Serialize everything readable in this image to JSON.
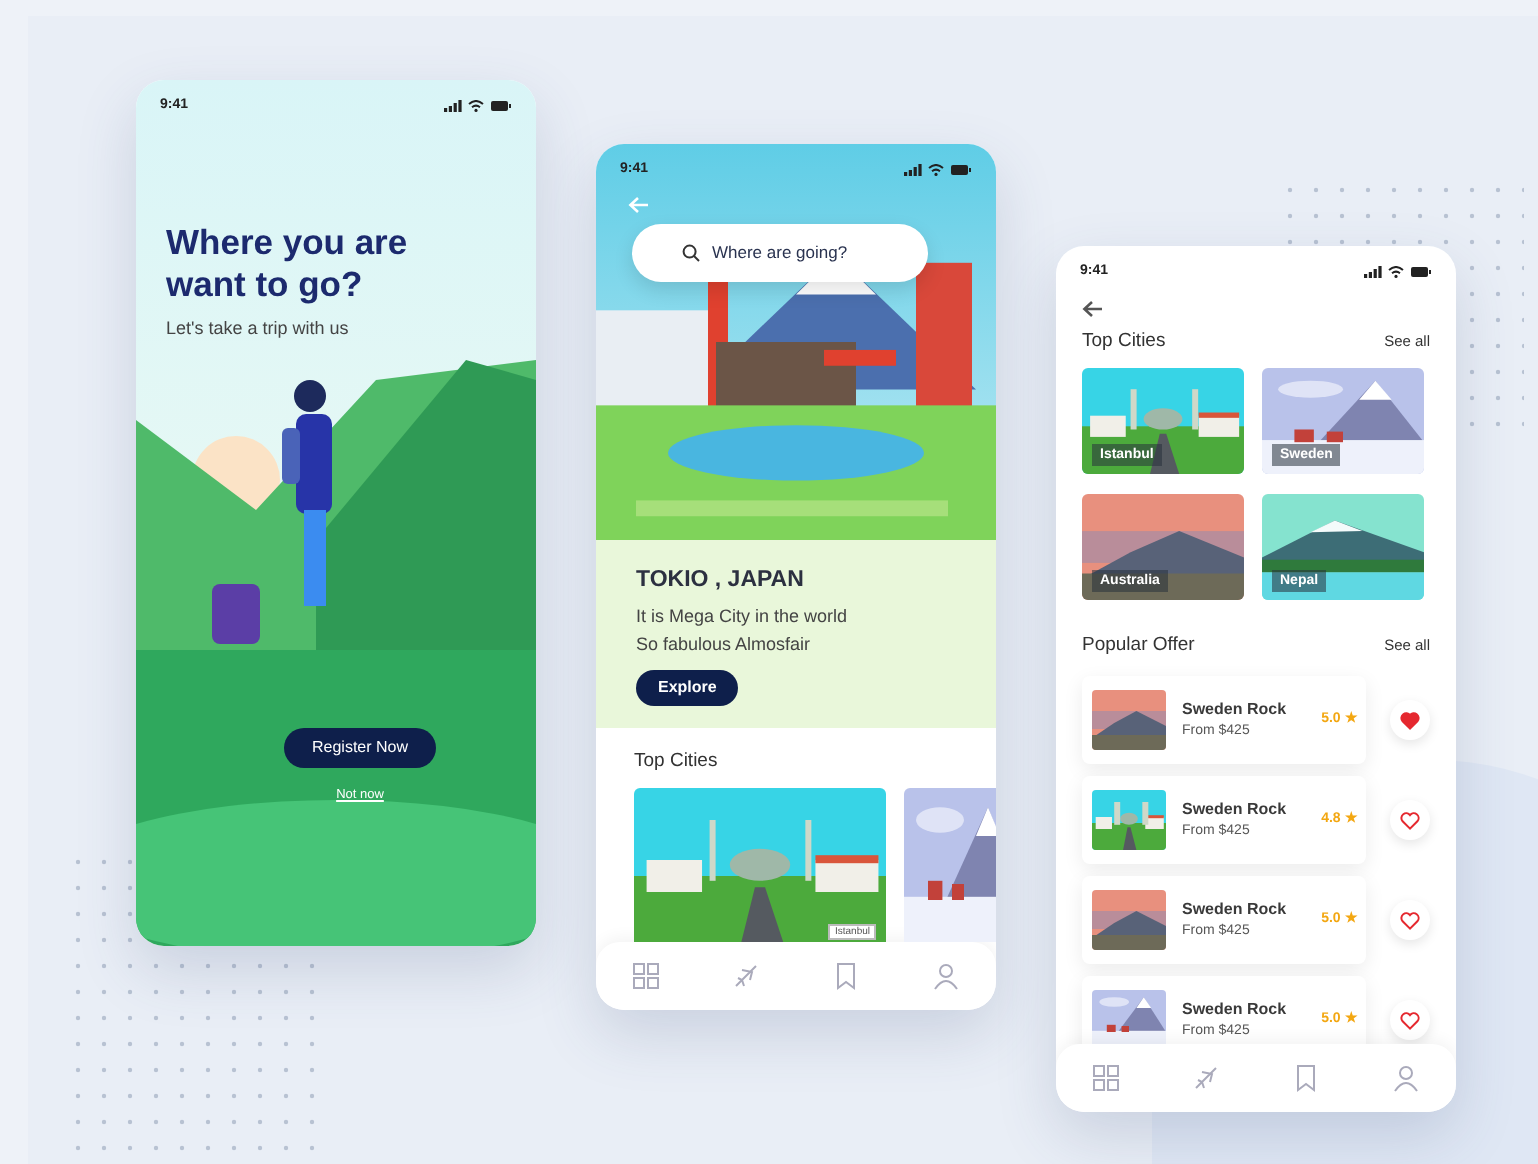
{
  "screens": [
    {
      "kind": "welcome",
      "status_time": "9:41",
      "title": "Where you are want to go?",
      "subtitle": "Let's take a trip with us",
      "primary_button": "Register Now",
      "link": "Not now"
    },
    {
      "kind": "city",
      "status_time": "9:41",
      "search_placeholder": "Where are going?",
      "city": "TOKIO , JAPAN",
      "description": "It is Mega City in the world\nSo fabulous Almosfair",
      "button": "Explore",
      "section_title": "Top Cities",
      "cities": [
        {
          "label": "Istanbul"
        },
        {
          "kind": "picture"
        }
      ]
    },
    {
      "kind": "list",
      "status_time": "9:41",
      "cities_title": "Top Cities",
      "cities_link": "See all",
      "cities": [
        {
          "label": "Istanbul"
        },
        {
          "label": "Sweden"
        },
        {
          "label": "Australia"
        },
        {
          "label": "Nepal"
        }
      ],
      "offers_title": "Popular Offer",
      "offers_link": "See all",
      "offers": [
        {
          "name": "Sweden Rock",
          "price": "From $425",
          "rating": "5.0 ★",
          "favorite": true
        },
        {
          "name": "Sweden Rock",
          "price": "From $425",
          "rating": "4.8 ★",
          "favorite": false
        },
        {
          "name": "Sweden Rock",
          "price": "From $425",
          "rating": "5.0 ★",
          "favorite": false
        },
        {
          "name": "Sweden Rock",
          "price": "From $425",
          "rating": "5.0 ★",
          "favorite": false
        }
      ]
    }
  ]
}
